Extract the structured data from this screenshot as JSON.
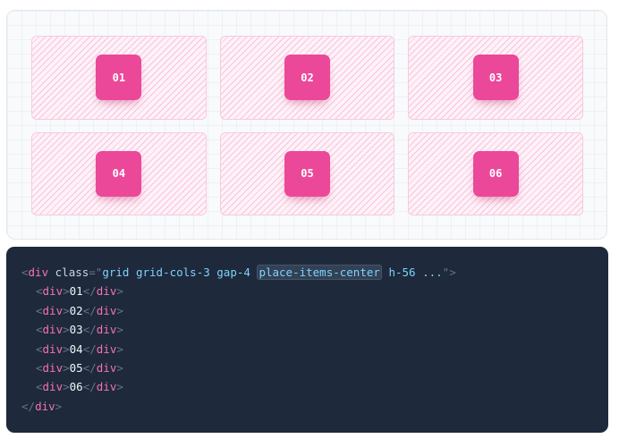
{
  "preview": {
    "items": [
      "01",
      "02",
      "03",
      "04",
      "05",
      "06"
    ]
  },
  "code": {
    "open_lt": "<",
    "tag_name": "div",
    "attr_name": "class",
    "equals_quote": "=\"",
    "class_before": "grid grid-cols-3 gap-4",
    "class_highlight": "place-items-center",
    "class_after": "h-56 ...",
    "close_quote_gt": "\">",
    "children": [
      {
        "open": "<",
        "tag": "div",
        "gt": ">",
        "text": "01",
        "close_lt": "</",
        "close_tag": "div",
        "close_gt": ">"
      },
      {
        "open": "<",
        "tag": "div",
        "gt": ">",
        "text": "02",
        "close_lt": "</",
        "close_tag": "div",
        "close_gt": ">"
      },
      {
        "open": "<",
        "tag": "div",
        "gt": ">",
        "text": "03",
        "close_lt": "</",
        "close_tag": "div",
        "close_gt": ">"
      },
      {
        "open": "<",
        "tag": "div",
        "gt": ">",
        "text": "04",
        "close_lt": "</",
        "close_tag": "div",
        "close_gt": ">"
      },
      {
        "open": "<",
        "tag": "div",
        "gt": ">",
        "text": "05",
        "close_lt": "</",
        "close_tag": "div",
        "close_gt": ">"
      },
      {
        "open": "<",
        "tag": "div",
        "gt": ">",
        "text": "06",
        "close_lt": "</",
        "close_tag": "div",
        "close_gt": ">"
      }
    ],
    "end_lt": "</",
    "end_tag": "div",
    "end_gt": ">"
  },
  "colors": {
    "tile": "#ec4899",
    "code_background": "#1e293b",
    "tag": "#f472b6",
    "string": "#7dd3fc"
  }
}
